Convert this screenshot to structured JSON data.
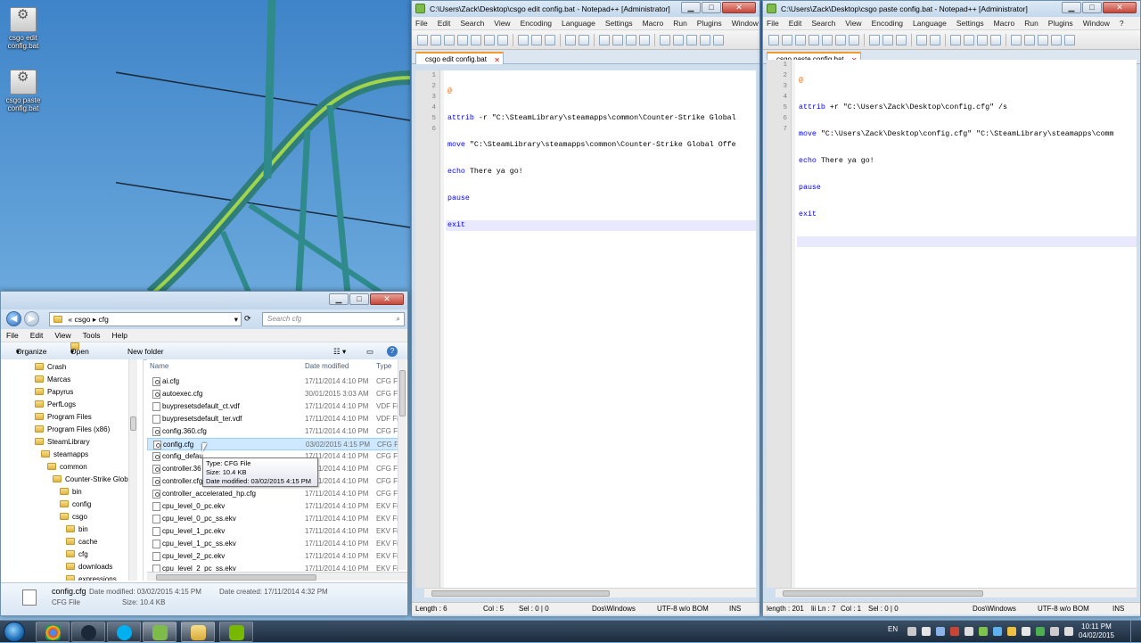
{
  "desktop": {
    "icons": [
      {
        "label": "csgo edit config.bat",
        "icon": "bat-file-icon"
      },
      {
        "label": "csgo paste config.bat",
        "icon": "bat-file-icon"
      }
    ]
  },
  "npp_left": {
    "title": "C:\\Users\\Zack\\Desktop\\csgo edit config.bat - Notepad++ [Administrator]",
    "menu": [
      "File",
      "Edit",
      "Search",
      "View",
      "Encoding",
      "Language",
      "Settings",
      "Macro",
      "Run",
      "Plugins",
      "Window",
      "?"
    ],
    "tab": "csgo edit config.bat",
    "line_numbers": [
      "1",
      "2",
      "3",
      "4",
      "5",
      "6"
    ],
    "lines": [
      {
        "kw": "@",
        "rest": ""
      },
      {
        "kw": "attrib",
        "rest": " -r \"C:\\SteamLibrary\\steamapps\\common\\Counter-Strike Global"
      },
      {
        "kw": "move",
        "rest": " \"C:\\SteamLibrary\\steamapps\\common\\Counter-Strike Global Offe"
      },
      {
        "kw": "echo",
        "rest": " There ya go!"
      },
      {
        "kw": "pause",
        "rest": ""
      },
      {
        "kw": "exit",
        "rest": ""
      }
    ],
    "status": {
      "length": "Length : 6",
      "pos": "Col : 5",
      "sel": "Sel : 0 | 0",
      "eol": "Dos\\Windows",
      "enc": "UTF-8 w/o BOM",
      "mode": "INS"
    }
  },
  "npp_right": {
    "title": "C:\\Users\\Zack\\Desktop\\csgo paste config.bat - Notepad++ [Administrator]",
    "menu": [
      "File",
      "Edit",
      "Search",
      "View",
      "Encoding",
      "Language",
      "Settings",
      "Macro",
      "Run",
      "Plugins",
      "Window",
      "?"
    ],
    "tab": "csgo paste config.bat",
    "line_numbers": [
      "1",
      "2",
      "3",
      "4",
      "5",
      "6",
      "7"
    ],
    "lines": [
      {
        "kw": "@",
        "rest": ""
      },
      {
        "kw": "attrib",
        "rest": " +r \"C:\\Users\\Zack\\Desktop\\config.cfg\" /s"
      },
      {
        "kw": "move",
        "rest": " \"C:\\Users\\Zack\\Desktop\\config.cfg\" \"C:\\SteamLibrary\\steamapps\\comm"
      },
      {
        "kw": "echo",
        "rest": " There ya go!"
      },
      {
        "kw": "pause",
        "rest": ""
      },
      {
        "kw": "exit",
        "rest": ""
      },
      {
        "kw": "",
        "rest": ""
      }
    ],
    "status": {
      "length": "length : 201",
      "pos": "lii Ln : 7",
      "col": "Col : 1",
      "sel": "Sel : 0 | 0",
      "eol": "Dos\\Windows",
      "enc": "UTF-8 w/o BOM",
      "mode": "INS"
    }
  },
  "explorer": {
    "breadcrumb": {
      "prefix": "«",
      "part1": "csgo",
      "part2": "cfg"
    },
    "search_placeholder": "Search cfg",
    "menu": [
      "File",
      "Edit",
      "View",
      "Tools",
      "Help"
    ],
    "commands": {
      "organize": "Organize",
      "open": "Open",
      "new_folder": "New folder"
    },
    "nav": [
      {
        "label": "Crash",
        "indent": 0
      },
      {
        "label": "Marcas",
        "indent": 0
      },
      {
        "label": "Papyrus",
        "indent": 0
      },
      {
        "label": "PerfLogs",
        "indent": 0
      },
      {
        "label": "Program Files",
        "indent": 0
      },
      {
        "label": "Program Files (x86)",
        "indent": 0
      },
      {
        "label": "SteamLibrary",
        "indent": 0
      },
      {
        "label": "steamapps",
        "indent": 1
      },
      {
        "label": "common",
        "indent": 2
      },
      {
        "label": "Counter-Strike Glob",
        "indent": 3
      },
      {
        "label": "bin",
        "indent": 4
      },
      {
        "label": "config",
        "indent": 4
      },
      {
        "label": "csgo",
        "indent": 4
      },
      {
        "label": "bin",
        "indent": 5
      },
      {
        "label": "cache",
        "indent": 5
      },
      {
        "label": "cfg",
        "indent": 5
      },
      {
        "label": "downloads",
        "indent": 5
      },
      {
        "label": "expressions",
        "indent": 5
      }
    ],
    "columns": {
      "name": "Name",
      "date": "Date modified",
      "type": "Type"
    },
    "files": [
      {
        "name": "ai.cfg",
        "date": "17/11/2014 4:10 PM",
        "type": "CFG Fi",
        "gear": true
      },
      {
        "name": "autoexec.cfg",
        "date": "30/01/2015 3:03 AM",
        "type": "CFG Fi",
        "gear": true
      },
      {
        "name": "buypresetsdefault_ct.vdf",
        "date": "17/11/2014 4:10 PM",
        "type": "VDF Fi",
        "gear": false
      },
      {
        "name": "buypresetsdefault_ter.vdf",
        "date": "17/11/2014 4:10 PM",
        "type": "VDF Fi",
        "gear": false
      },
      {
        "name": "config.360.cfg",
        "date": "17/11/2014 4:10 PM",
        "type": "CFG Fi",
        "gear": true
      },
      {
        "name": "config.cfg",
        "date": "03/02/2015 4:15 PM",
        "type": "CFG Fi",
        "gear": true,
        "selected": true
      },
      {
        "name": "config_defau",
        "date": "17/11/2014 4:10 PM",
        "type": "CFG Fi",
        "gear": true
      },
      {
        "name": "controller.36",
        "date": "17/11/2014 4:10 PM",
        "type": "CFG Fi",
        "gear": true
      },
      {
        "name": "controller.cfg",
        "date": "17/11/2014 4:10 PM",
        "type": "CFG Fi",
        "gear": true
      },
      {
        "name": "controller_accelerated_hp.cfg",
        "date": "17/11/2014 4:10 PM",
        "type": "CFG Fi",
        "gear": true
      },
      {
        "name": "cpu_level_0_pc.ekv",
        "date": "17/11/2014 4:10 PM",
        "type": "EKV Fi",
        "gear": false
      },
      {
        "name": "cpu_level_0_pc_ss.ekv",
        "date": "17/11/2014 4:10 PM",
        "type": "EKV Fi",
        "gear": false
      },
      {
        "name": "cpu_level_1_pc.ekv",
        "date": "17/11/2014 4:10 PM",
        "type": "EKV Fi",
        "gear": false
      },
      {
        "name": "cpu_level_1_pc_ss.ekv",
        "date": "17/11/2014 4:10 PM",
        "type": "EKV Fi",
        "gear": false
      },
      {
        "name": "cpu_level_2_pc.ekv",
        "date": "17/11/2014 4:10 PM",
        "type": "EKV Fi",
        "gear": false
      },
      {
        "name": "cpu_level_2_pc_ss.ekv",
        "date": "17/11/2014 4:10 PM",
        "type": "EKV Fi",
        "gear": false
      }
    ],
    "tooltip": [
      "Type: CFG File",
      "Size: 10.4 KB",
      "Date modified: 03/02/2015 4:15 PM"
    ],
    "details": {
      "name": "config.cfg",
      "type": "CFG File",
      "date_modified": "Date modified: 03/02/2015 4:15 PM",
      "size": "Size: 10.4 KB",
      "date_created": "Date created: 17/11/2014 4:32 PM"
    }
  },
  "taskbar": {
    "apps": [
      "chrome-icon",
      "steam-icon",
      "skype-icon",
      "notepadpp-icon",
      "explorer-icon",
      "nvidia-icon"
    ],
    "lang": "EN",
    "time": "10:11 PM",
    "date": "04/02/2015"
  },
  "colors": {
    "keyword": "#0000ff",
    "operator": "#ff6a00",
    "selection": "#cde8ff",
    "accent": "#f29b2c"
  }
}
